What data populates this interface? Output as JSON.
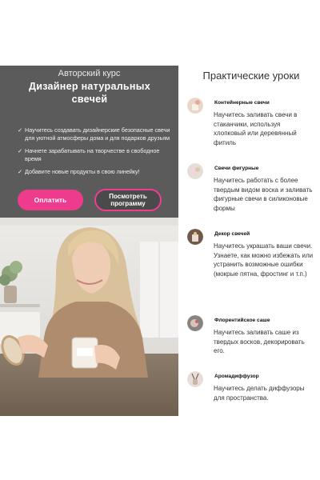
{
  "course": {
    "subtitle": "Авторский курс",
    "title": "Дизайнер натуральных свечей",
    "bullets": [
      "Научитесь создавать дизайнерские безопасные свечи для уютной атмосферы дома и для подарков друзьям",
      "Начнете зарабатывать на творчестве в свободное время",
      "Добавите новые продукты в свою линейку!"
    ],
    "check_symbol": "✓",
    "pay_button": "Оплатить",
    "program_button": "Посмотреть программу"
  },
  "lessons": {
    "title": "Практические уроки",
    "items": [
      {
        "name": "Контейнерные свечи",
        "desc": "Научитесь заливать свечи в стаканчики, используя хлопковый или деревянный фитиль",
        "icon": "candle-icon"
      },
      {
        "name": "Свечи фигурные",
        "desc": "Научитесь работать с более твердым видом воска и заливать фигурные свечи в силиконовые формы",
        "icon": "figure-candle-icon"
      },
      {
        "name": "Декор свечей",
        "desc": "Научитесь украшать ваши свечи.\nУзнаете, как можно избежать или устранить возможные ошибки (мокрые пятна, фростинг и т.п.)",
        "icon": "decor-icon"
      },
      {
        "name": "Флорентийское саше",
        "desc": "Научитесь заливать саше из твердых восков, декорировать его.",
        "icon": "sachet-icon"
      },
      {
        "name": "Аромадиффузор",
        "desc": "Научитесь делать диффузоры для пространства.",
        "icon": "diffuser-icon"
      }
    ]
  },
  "colors": {
    "accent": "#ee3b8e",
    "hero_bg": "#5b5b5b"
  }
}
